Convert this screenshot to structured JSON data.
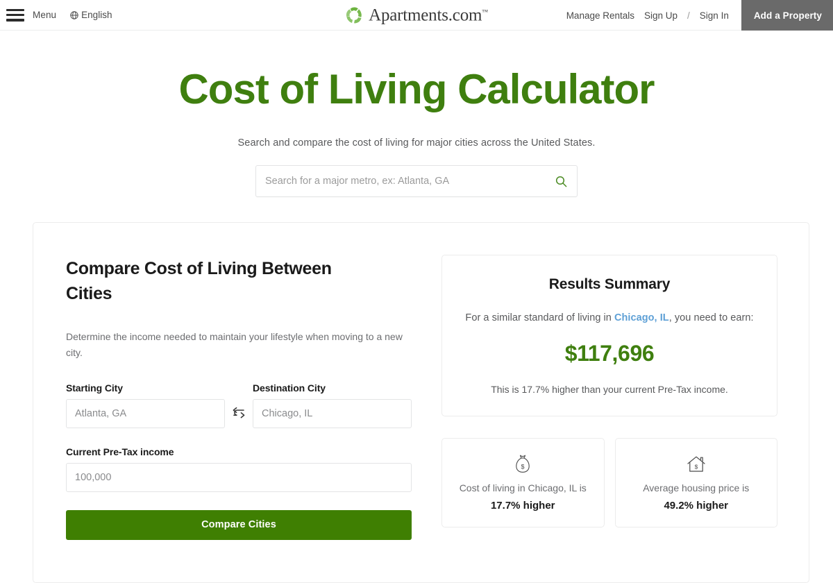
{
  "header": {
    "menu_label": "Menu",
    "language_label": "English",
    "language_icon": "globe-icon",
    "menu_icon": "hamburger-icon",
    "logo_text": "Apartments.com",
    "logo_trademark": "™",
    "logo_icon": "apartments-pinwheel-logo",
    "manage_rentals": "Manage Rentals",
    "sign_up": "Sign Up",
    "separator": "/",
    "sign_in": "Sign In",
    "add_property": "Add a Property",
    "add_property_bg": "#6a6a6a"
  },
  "hero": {
    "title": "Cost of Living Calculator",
    "title_color": "#3f7f0f",
    "subtitle": "Search and compare the cost of living for major cities across the United States."
  },
  "search": {
    "placeholder": "Search for a major metro, ex: Atlanta, GA",
    "value": "",
    "icon": "search-icon"
  },
  "compare_panel": {
    "heading": "Compare Cost of Living Between Cities",
    "description": "Determine the income needed to maintain your lifestyle when moving to a new city.",
    "starting_city": {
      "label": "Starting City",
      "placeholder": "Atlanta, GA",
      "value": ""
    },
    "destination_city": {
      "label": "Destination City",
      "placeholder": "Chicago, IL",
      "value": ""
    },
    "swap_icon": "swap-arrows-icon",
    "income": {
      "label": "Current Pre-Tax income",
      "placeholder": "100,000",
      "value": ""
    },
    "submit_label": "Compare Cities",
    "submit_color": "#3f7f02"
  },
  "results": {
    "title": "Results Summary",
    "intro_prefix": "For a similar standard of living in ",
    "city_link": "Chicago, IL",
    "city_link_color": "#5ea0d6",
    "intro_suffix": ", you need to earn:",
    "amount": "$117,696",
    "amount_color": "#3f7f0f",
    "note": "This is 17.7% higher than your current Pre-Tax income."
  },
  "stats": [
    {
      "icon": "money-bag-icon",
      "label": "Cost of living in Chicago, IL is",
      "value": "17.7% higher"
    },
    {
      "icon": "house-dollar-icon",
      "label": "Average housing price is",
      "value": "49.2% higher"
    }
  ]
}
